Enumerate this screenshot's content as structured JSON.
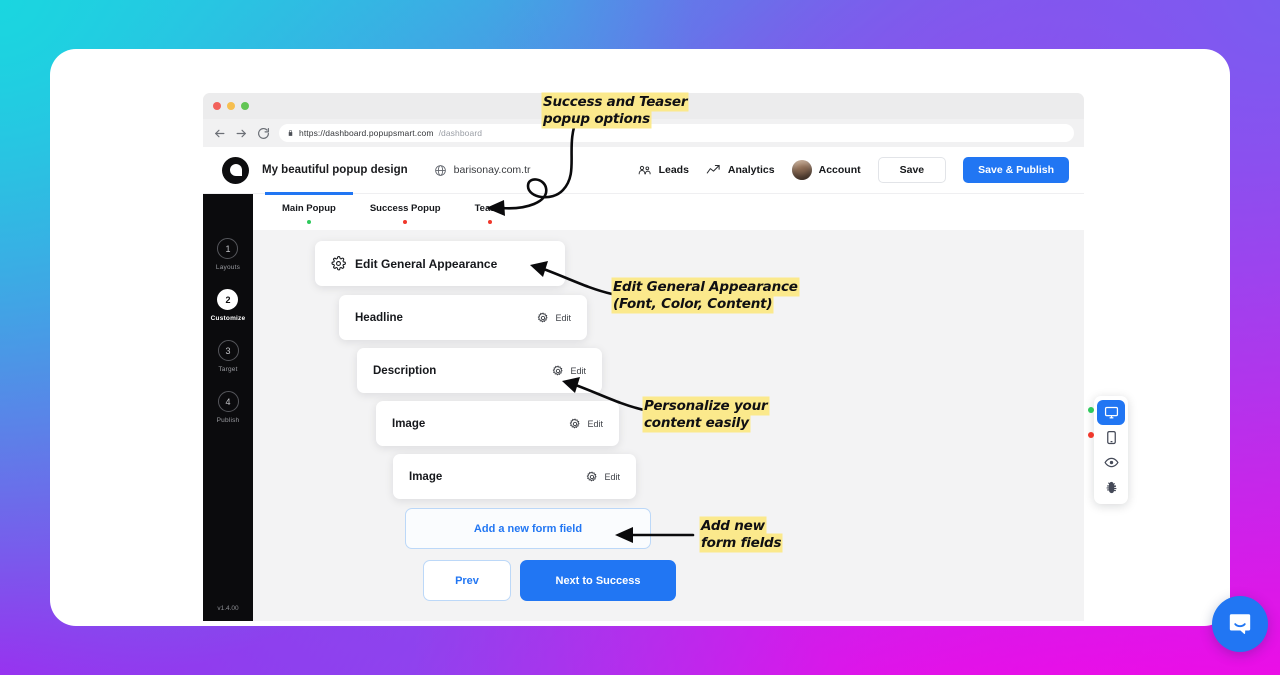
{
  "browser": {
    "url_main": "https://dashboard.popupsmart.com",
    "url_path": "/dashboard",
    "back_icon": "arrow-left-icon",
    "forward_icon": "arrow-right-icon",
    "reload_icon": "reload-icon",
    "lock_icon": "lock-icon"
  },
  "header": {
    "logo_icon": "popupsmart-logo-icon",
    "project_title": "My beautiful popup design",
    "site_icon": "globe-icon",
    "site_domain": "barisonay.com.tr",
    "leads_label": "Leads",
    "leads_icon": "leads-people-icon",
    "analytics_label": "Analytics",
    "analytics_icon": "analytics-chart-icon",
    "account_label": "Account",
    "save_label": "Save",
    "publish_label": "Save & Publish"
  },
  "sidebar": {
    "steps": [
      {
        "num": "1",
        "label": "Layouts",
        "active": false
      },
      {
        "num": "2",
        "label": "Customize",
        "active": true
      },
      {
        "num": "3",
        "label": "Target",
        "active": false
      },
      {
        "num": "4",
        "label": "Publish",
        "active": false
      }
    ],
    "version": "v1.4.00"
  },
  "tabs": [
    {
      "label": "Main Popup",
      "dot_color": "#2ec95c",
      "active": true
    },
    {
      "label": "Success Popup",
      "dot_color": "#f0372b",
      "active": false
    },
    {
      "label": "Teaser",
      "dot_color": "#f0372b",
      "active": false
    }
  ],
  "editor": {
    "general_label": "Edit General Appearance",
    "general_icon": "gear-icon",
    "edit_label": "Edit",
    "edit_icon": "gear-icon",
    "rows": [
      {
        "label": "Headline"
      },
      {
        "label": "Description"
      },
      {
        "label": "Image"
      },
      {
        "label": "Image"
      }
    ],
    "add_field_label": "Add a new form field",
    "prev_label": "Prev",
    "next_label": "Next to Success"
  },
  "devicebar": {
    "items": [
      {
        "icon": "desktop-icon",
        "active": true,
        "pip": "#2ec95c"
      },
      {
        "icon": "mobile-icon",
        "active": false,
        "pip": "#f0372b"
      },
      {
        "icon": "eye-preview-icon",
        "active": false,
        "pip": ""
      },
      {
        "icon": "bug-debug-icon",
        "active": false,
        "pip": ""
      }
    ]
  },
  "intercom": {
    "icon": "chat-bubble-icon"
  },
  "annotations": [
    {
      "line1": "Success and Teaser",
      "line2": "popup options"
    },
    {
      "line1": "Edit General Appearance",
      "line2": "(Font, Color, Content)"
    },
    {
      "line1": "Personalize your",
      "line2": "content easily"
    },
    {
      "line1": "Add new",
      "line2": "form fields"
    }
  ],
  "colors": {
    "accent_blue": "#2176f3",
    "highlight_yellow": "#fbe98c",
    "sidebar_black": "#0b0b0d",
    "status_green": "#2ec95c",
    "status_red": "#f0372b"
  }
}
